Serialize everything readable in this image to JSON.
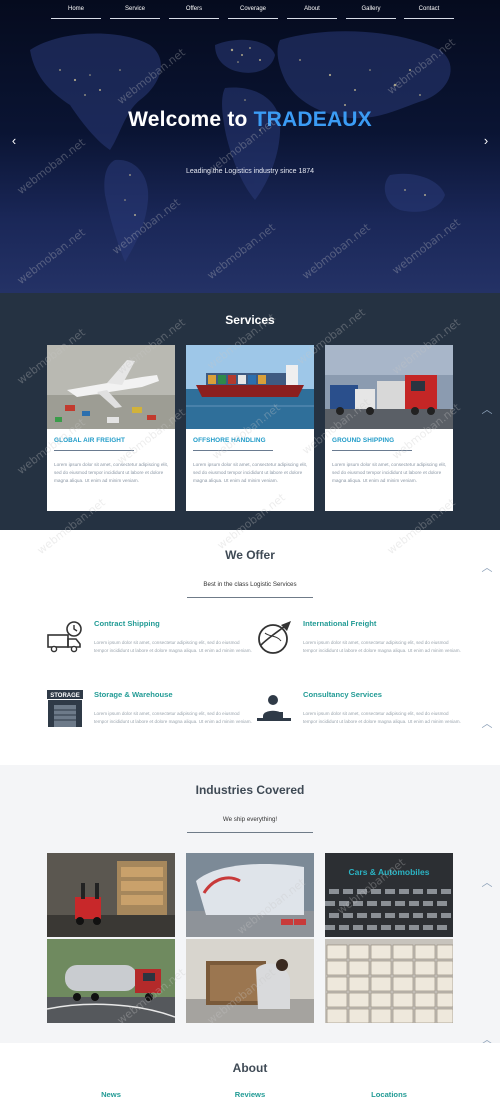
{
  "nav": {
    "items": [
      "Home",
      "Service",
      "Offers",
      "Coverage",
      "About",
      "Gallery",
      "Contact"
    ]
  },
  "hero": {
    "title_prefix": "Welcome to ",
    "title_brand": "TRADEAUX",
    "subtitle": "Leading the Logistics industry since 1874",
    "prev_arrow": "‹",
    "next_arrow": "›"
  },
  "services": {
    "title": "Services",
    "cards": [
      {
        "title": "GLOBAL AIR FREIGHT",
        "text": "Lorem ipsum dolor sit amet, consectetur adipiscing elit, sed do eiusmod tempor incididunt ut labore et dolore magna aliqua. Ut enim ad minim veniam."
      },
      {
        "title": "OFFSHORE HANDLING",
        "text": "Lorem ipsum dolor sit amet, consectetur adipiscing elit, sed do eiusmod tempor incididunt ut labore et dolore magna aliqua. Ut enim ad minim veniam."
      },
      {
        "title": "GROUND SHIPPING",
        "text": "Lorem ipsum dolor sit amet, consectetur adipiscing elit, sed do eiusmod tempor incididunt ut labore et dolore magna aliqua. Ut enim ad minim veniam."
      }
    ]
  },
  "offer": {
    "title": "We Offer",
    "subtitle": "Best in the class Logistic Services",
    "items": [
      {
        "title": "Contract Shipping",
        "text": "Lorem ipsum dolor sit amet, consectetur adipiscing elit, sed do eiusmod tempor incididunt ut labore et dolore magna aliqua. Ut enim ad minim veniam.",
        "icon": "truck-clock-icon"
      },
      {
        "title": "International Freight",
        "text": "Lorem ipsum dolor sit amet, consectetur adipiscing elit, sed do eiusmod tempor incididunt ut labore et dolore magna aliqua. Ut enim ad minim veniam.",
        "icon": "globe-plane-icon"
      },
      {
        "title": "Storage & Warehouse",
        "text": "Lorem ipsum dolor sit amet, consectetur adipiscing elit, sed do eiusmod tempor incididunt ut labore et dolore magna aliqua. Ut enim ad minim veniam.",
        "icon": "warehouse-icon",
        "icon_label": "STORAGE"
      },
      {
        "title": "Consultancy Services",
        "text": "Lorem ipsum dolor sit amet, consectetur adipiscing elit, sed do eiusmod tempor incididunt ut labore et dolore magna aliqua. Ut enim ad minim veniam.",
        "icon": "consultant-icon"
      }
    ]
  },
  "industries": {
    "title": "Industries Covered",
    "subtitle": "We ship everything!",
    "tiles": [
      {
        "label": ""
      },
      {
        "label": ""
      },
      {
        "label": "Cars & Automobiles"
      },
      {
        "label": ""
      },
      {
        "label": ""
      },
      {
        "label": ""
      }
    ]
  },
  "about": {
    "title": "About",
    "links": [
      "News",
      "Reviews",
      "Locations"
    ]
  },
  "scroll_up_glyph": "︿",
  "watermark": "webmoban.net",
  "colors": {
    "brand_blue": "#3b9cf5",
    "service_title": "#1f9bc8",
    "teal": "#229b95",
    "services_bg": "#253242"
  }
}
